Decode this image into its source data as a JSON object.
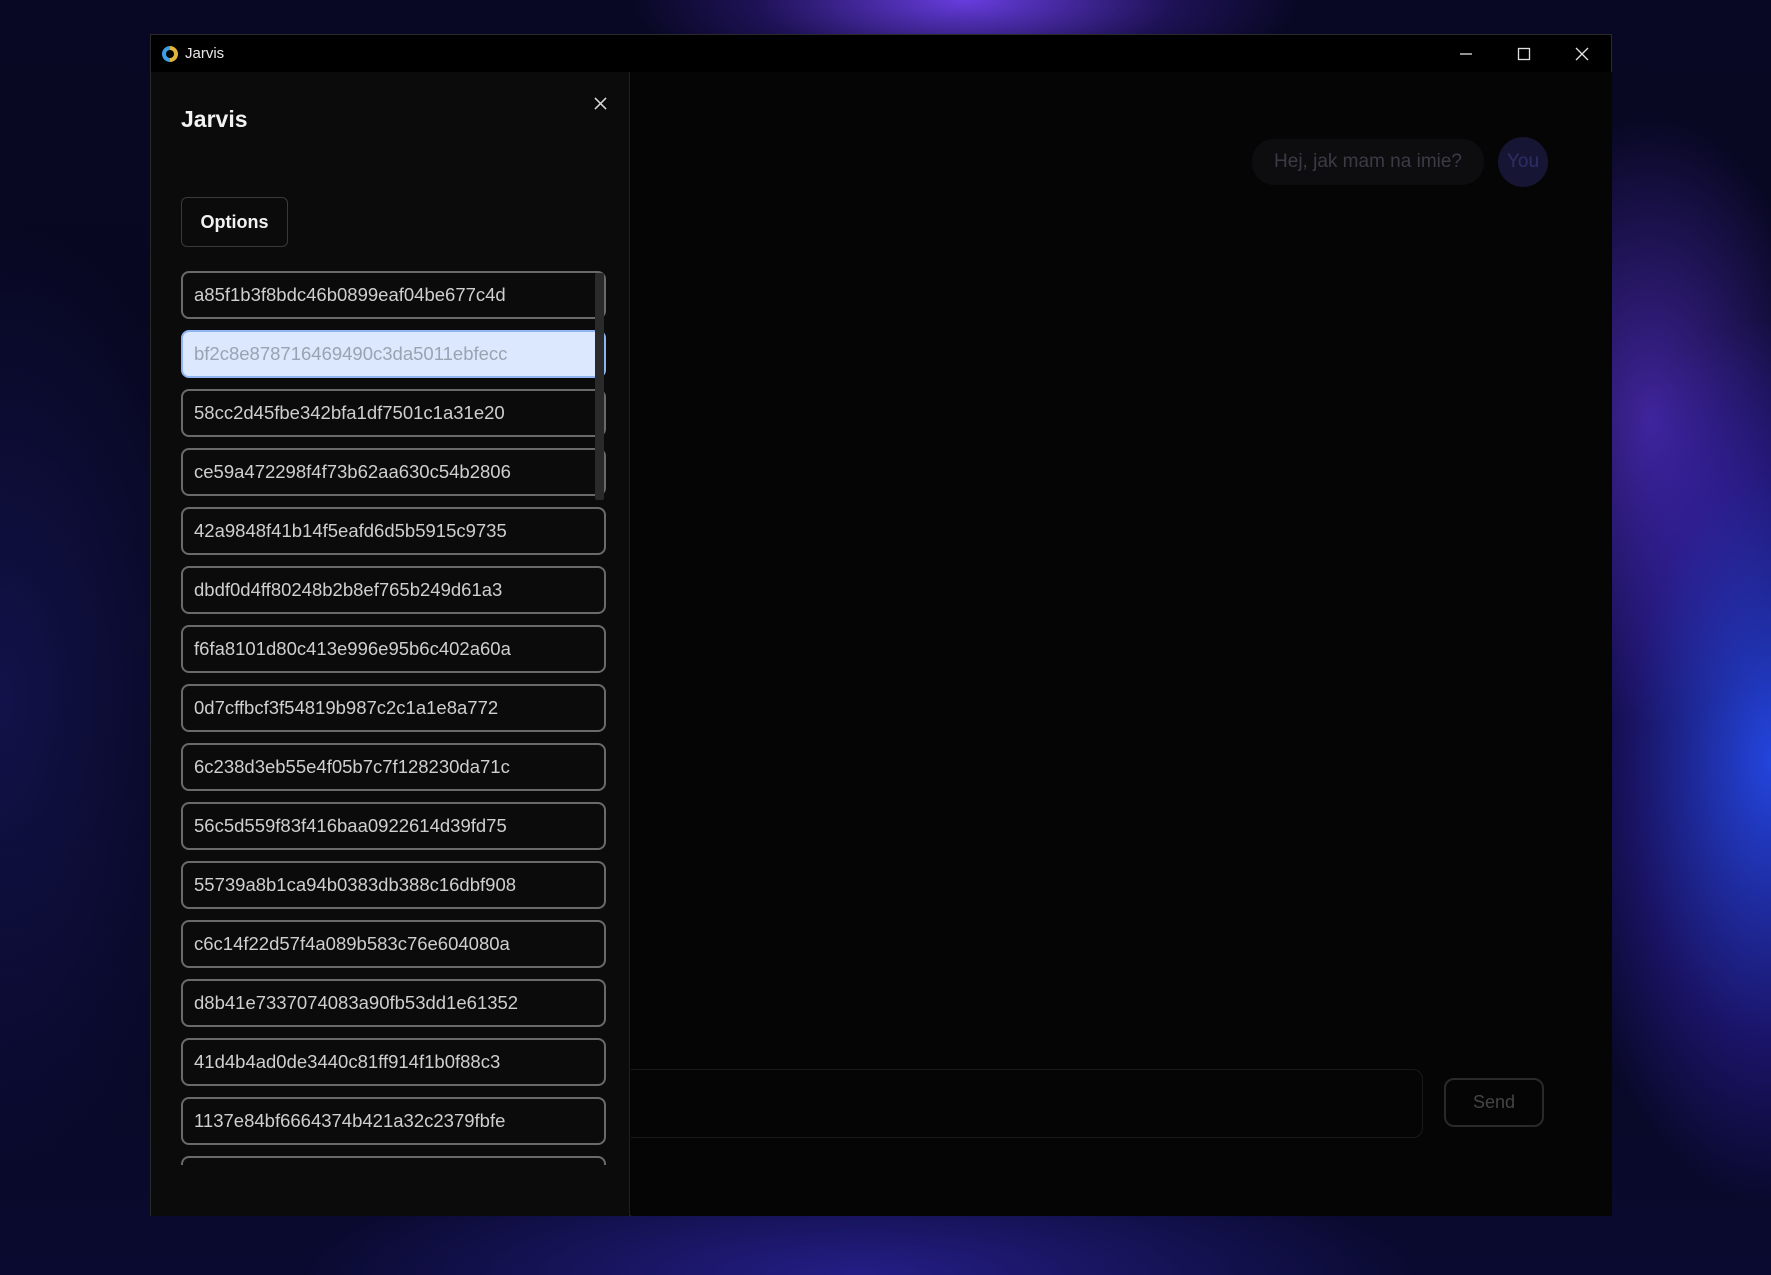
{
  "window": {
    "title": "Jarvis",
    "controls": [
      "minimize-icon",
      "maximize-icon",
      "close-icon"
    ]
  },
  "sidebar": {
    "title": "Jarvis",
    "close_icon": "close-icon",
    "options_label": "Options",
    "selected_index": 1,
    "chats": [
      "a85f1b3f8bdc46b0899eaf04be677c4d",
      "bf2c8e878716469490c3da5011ebfecc",
      "58cc2d45fbe342bfa1df7501c1a31e20",
      "ce59a472298f4f73b62aa630c54b2806",
      "42a9848f41b14f5eafd6d5b5915c9735",
      "dbdf0d4ff80248b2b8ef765b249d61a3",
      "f6fa8101d80c413e996e95b6c402a60a",
      "0d7cffbcf3f54819b987c2c1a1e8a772",
      "6c238d3eb55e4f05b7c7f128230da71c",
      "56c5d559f83f416baa0922614d39fd75",
      "55739a8b1ca94b0383db388c16dbf908",
      "c6c14f22d57f4a089b583c76e604080a",
      "d8b41e7337074083a90fb53dd1e61352",
      "41d4b4ad0de3440c81ff914f1b0f88c3",
      "1137e84bf6664374b421a32c2379fbfe",
      ""
    ]
  },
  "chat": {
    "messages": [
      {
        "text": "Hej, jak mam na imie?",
        "author": "You"
      }
    ],
    "input_value": "",
    "send_label": "Send"
  },
  "colors": {
    "selected_bg": "#dbe8fd",
    "selected_border": "#8fb4f0",
    "item_border": "#6a6a6a"
  }
}
